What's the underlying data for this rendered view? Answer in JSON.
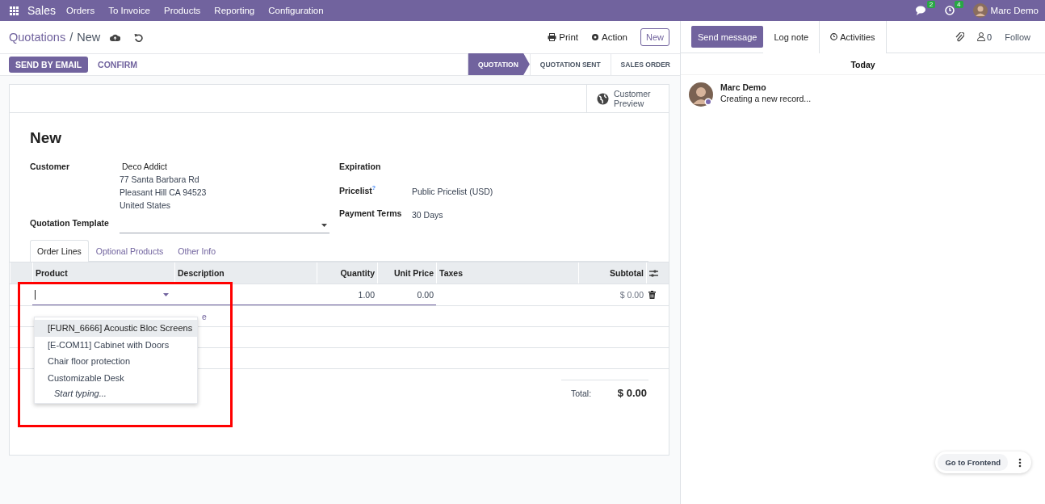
{
  "navbar": {
    "app": "Sales",
    "menu": [
      "Orders",
      "To Invoice",
      "Products",
      "Reporting",
      "Configuration"
    ],
    "messages_count": "2",
    "activities_count": "4",
    "user": "Marc Demo"
  },
  "breadcrumb": {
    "parent": "Quotations",
    "separator": "/",
    "current": "New"
  },
  "actions": {
    "print": "Print",
    "action": "Action",
    "new": "New"
  },
  "buttons": [
    {
      "label": "SEND BY EMAIL",
      "primary": true
    },
    {
      "label": "CONFIRM",
      "primary": false
    }
  ],
  "statusbar": [
    {
      "label": "QUOTATION",
      "selected": true
    },
    {
      "label": "QUOTATION SENT",
      "selected": false
    },
    {
      "label": "SALES ORDER",
      "selected": false
    }
  ],
  "customer_preview": "Customer Preview",
  "title": "New",
  "customer": {
    "label": "Customer",
    "name": "Deco Addict",
    "address": [
      "77 Santa Barbara Rd",
      "Pleasant Hill CA 94523",
      "United States"
    ]
  },
  "quotation_template": {
    "label": "Quotation Template"
  },
  "right_fields": [
    {
      "label": "Expiration"
    },
    {
      "label": "Pricelist",
      "help": "?",
      "value": "Public Pricelist (USD)"
    },
    {
      "label": "Payment Terms",
      "value": "30 Days"
    }
  ],
  "tabs": [
    {
      "label": "Order Lines",
      "selected": true
    },
    {
      "label": "Optional Products",
      "selected": false
    },
    {
      "label": "Other Info",
      "selected": false
    }
  ],
  "table": {
    "columns": [
      "Product",
      "Description",
      "Quantity",
      "Unit Price",
      "Taxes",
      "Subtotal"
    ],
    "rows": [
      {
        "cells": [
          "",
          "",
          "1.00",
          "0.00",
          "",
          "$ 0.00"
        ]
      }
    ],
    "partly_hidden_link": "e"
  },
  "dropdown": {
    "items": [
      {
        "label": "[FURN_6666] Acoustic Bloc Screens",
        "selected": true
      },
      {
        "label": "[E-COM11] Cabinet with Doors",
        "selected": false
      },
      {
        "label": "Chair floor protection",
        "selected": false
      },
      {
        "label": "Customizable Desk",
        "selected": false
      }
    ],
    "footer": "Start typing..."
  },
  "total": {
    "label": "Total:",
    "value": "$ 0.00"
  },
  "chatter": {
    "buttons": [
      {
        "label": "Send message",
        "selected": true
      },
      {
        "label": "Log note",
        "selected": false
      },
      {
        "label": "Activities",
        "selected": false
      }
    ],
    "followers_count": "0",
    "follow": "Follow",
    "date": "Today",
    "messages": [
      {
        "author": "Marc Demo",
        "body": "Creating a new record..."
      }
    ]
  },
  "floating": {
    "label": "Go to Frontend"
  }
}
